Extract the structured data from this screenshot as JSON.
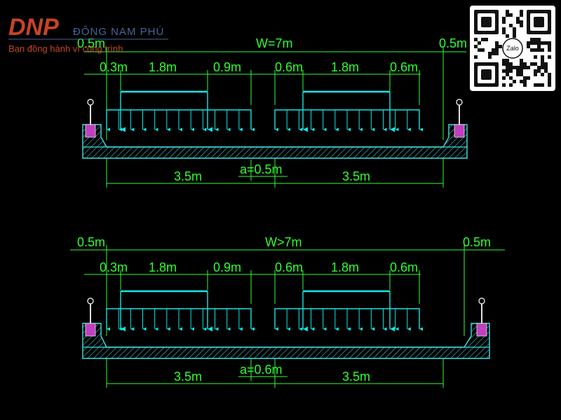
{
  "brand": {
    "mark": "DNP",
    "name": "ĐÔNG NAM PHÚ",
    "tagline": "Bạn đồng hành vì công trình"
  },
  "qr": {
    "label": "Zalo"
  },
  "colors": {
    "dimension": "#2fff2f",
    "load": "#14e6e6",
    "slab": "#3fe0e0",
    "hatch": "#3fd0d0",
    "curb_fill": "#c040c0",
    "railing": "#e0e0e0",
    "background": "#000000",
    "logo": "#d64a2a",
    "logo_name": "#4e6fa8"
  },
  "sections": [
    {
      "width_label": "W=7m",
      "left_sidewalk": "0.5m",
      "right_sidewalk": "0.5m",
      "vehicle_left": {
        "edge": "0.3m",
        "track": "1.8m",
        "inner": "0.9m"
      },
      "vehicle_right": {
        "inner": "0.6m",
        "track": "1.8m",
        "edge": "0.6m"
      },
      "lane_left": "3.5m",
      "lane_right": "3.5m",
      "gap": "a=0.5m"
    },
    {
      "width_label": "W>7m",
      "left_sidewalk": "0.5m",
      "right_sidewalk": "0.5m",
      "vehicle_left": {
        "edge": "0.3m",
        "track": "1.8m",
        "inner": "0.9m"
      },
      "vehicle_right": {
        "inner": "0.6m",
        "track": "1.8m",
        "edge": "0.6m"
      },
      "lane_left": "3.5m",
      "lane_right": "3.5m",
      "gap": "a=0.6m"
    }
  ]
}
